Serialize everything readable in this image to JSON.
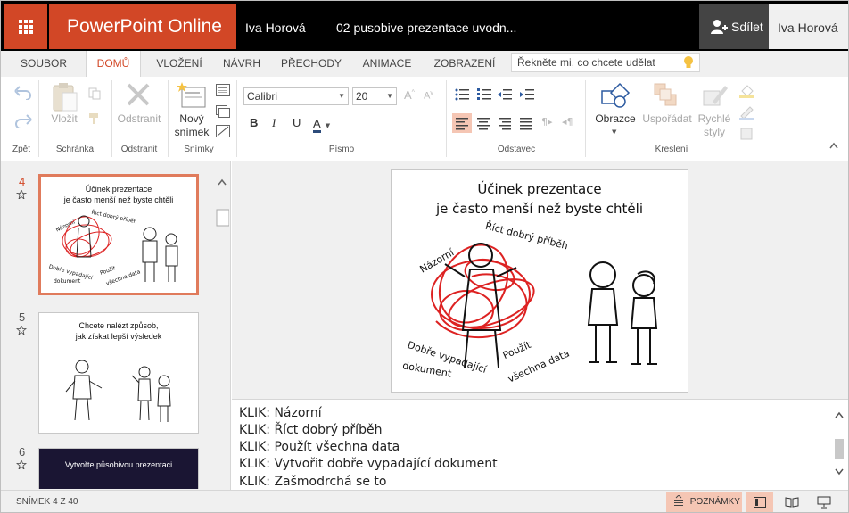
{
  "header": {
    "app_name": "PowerPoint Online",
    "user_left": "Iva Horová",
    "document_title": "02 pusobive prezentace uvodn...",
    "share_label": "Sdílet",
    "user_right": "Iva Horová"
  },
  "tabs": [
    "SOUBOR",
    "DOMŮ",
    "VLOŽENÍ",
    "NÁVRH",
    "PŘECHODY",
    "ANIMACE",
    "ZOBRAZENÍ"
  ],
  "active_tab": "DOMŮ",
  "tell_me": {
    "placeholder": "Řekněte mi, co chcete udělat"
  },
  "ribbon": {
    "groups": {
      "undo": "Zpět",
      "clipboard": "Schránka",
      "delete": "Odstranit",
      "slides": "Snímky",
      "font": "Písmo",
      "paragraph": "Odstavec",
      "drawing": "Kreslení"
    },
    "paste": "Vložit",
    "delete_btn": "Odstranit",
    "new_slide_1": "Nový",
    "new_slide_2": "snímek",
    "font_name": "Calibri",
    "font_size": "20",
    "bold": "B",
    "italic": "I",
    "underline": "U",
    "font_color": "A",
    "shapes": "Obrazce",
    "arrange": "Uspořádat",
    "quick_styles_1": "Rychlé",
    "quick_styles_2": "styly"
  },
  "thumbnails": [
    {
      "num": "4",
      "title_1": "Účinek prezentace",
      "title_2": "je často menší než byste chtěli",
      "lbl_a": "Názorní",
      "lbl_b": "Říct dobrý příběh",
      "lbl_c": "Dobře vypadající",
      "lbl_d": "dokument",
      "lbl_e": "Použít",
      "lbl_f": "všechna data"
    },
    {
      "num": "5",
      "title_1": "Chcete nalézt způsob,",
      "title_2": "jak získat lepší výsledek"
    },
    {
      "num": "6",
      "title_1": "Vytvořte působivou prezentaci"
    }
  ],
  "slide": {
    "title_1": "Účinek prezentace",
    "title_2": "je často menší než byste chtěli",
    "label_nazorni": "Názorní",
    "label_pribeh": "Říct dobrý příběh",
    "label_dokument_1": "Dobře vypadající",
    "label_dokument_2": "dokument",
    "label_data_1": "Použít",
    "label_data_2": "všechna data"
  },
  "notes": [
    "KLIK: Názorní",
    "KLIK: Říct dobrý příběh",
    "KLIK: Použít všechna data",
    "KLIK: Vytvořit dobře vypadající dokument",
    "KLIK: Zašmodrchá se to"
  ],
  "status": {
    "slide_count": "SNÍMEK 4 Z 40",
    "notes_button": "POZNÁMKY"
  },
  "colors": {
    "accent": "#d24726",
    "selection": "#e07b5c",
    "notes_active": "#f5c6b4"
  }
}
